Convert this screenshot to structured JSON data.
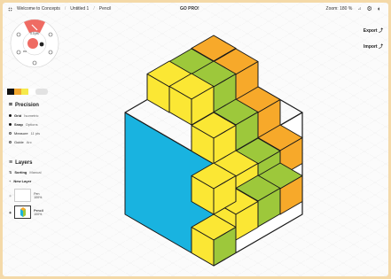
{
  "topbar": {
    "breadcrumb": [
      "Welcome to Concepts",
      "Untitled 1",
      "Pencil"
    ],
    "center": "GO PRO!",
    "zoom": "Zoom: 180 %"
  },
  "actions": {
    "export": "Export",
    "import": "Import"
  },
  "brush": {
    "size": "0.0 pts",
    "opacity": "0%"
  },
  "swatches": [
    "#111111",
    "#f2a72e",
    "#f5e94b",
    "#ffffff",
    "#e2e2e2"
  ],
  "precision": {
    "title": "Precision",
    "grid_label": "Grid",
    "grid_value": "Isometric",
    "snap_label": "Snap",
    "snap_value": "Options",
    "measure_label": "Measure",
    "measure_value": "11 pts",
    "guide_label": "Guide",
    "guide_value": "Arc"
  },
  "layers": {
    "title": "Layers",
    "sorting_label": "Sorting",
    "sorting_value": "Manual",
    "new_layer": "New Layer",
    "items": [
      {
        "name": "Pen",
        "opacity": "100%"
      },
      {
        "name": "Pencil",
        "opacity": "100%"
      }
    ]
  },
  "colors": {
    "blue": "#19b3e0",
    "green": "#9dc83b",
    "yellow": "#fbe734",
    "orange": "#f7a92a",
    "accent": "#ef6b63"
  }
}
